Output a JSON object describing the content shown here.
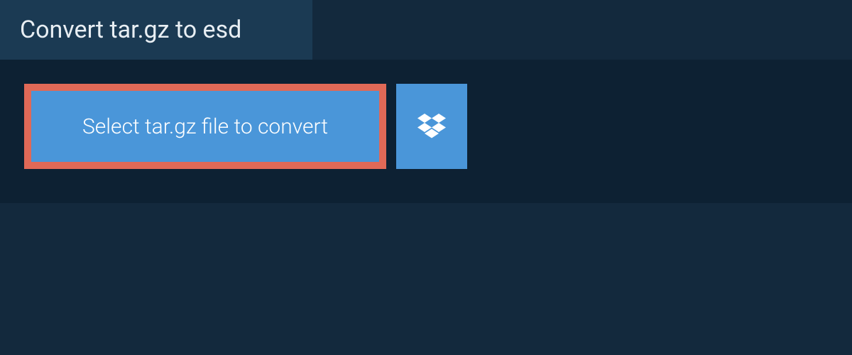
{
  "header": {
    "title": "Convert tar.gz to esd"
  },
  "upload": {
    "select_label": "Select tar.gz file to convert",
    "dropbox_icon": "dropbox-icon"
  }
}
